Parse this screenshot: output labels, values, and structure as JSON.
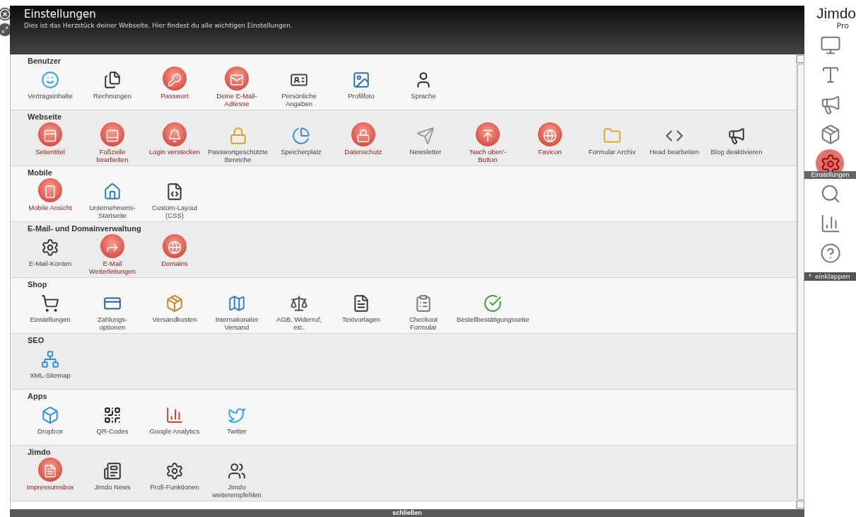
{
  "header": {
    "title": "Einstellungen",
    "subtitle": "Dies ist das Herzstück deiner Webseite. Hier findest du alle wichtigen Einstellungen."
  },
  "sections": [
    {
      "title": "Benutzer",
      "items": [
        {
          "label": "Vertragsinhalte",
          "highlighted": false
        },
        {
          "label": "Rechnungen",
          "highlighted": false
        },
        {
          "label": "Passwort",
          "highlighted": true
        },
        {
          "label": "Deine E-Mail-\nAdresse",
          "highlighted": true
        },
        {
          "label": "Persönliche\nAngaben",
          "highlighted": false
        },
        {
          "label": "Profilfoto",
          "highlighted": false
        },
        {
          "label": "Sprache",
          "highlighted": false
        }
      ]
    },
    {
      "title": "Webseite",
      "items": [
        {
          "label": "Seitentitel",
          "highlighted": true
        },
        {
          "label": "Fußzeile\nbearbeiten",
          "highlighted": true
        },
        {
          "label": "Login verstecken",
          "highlighted": true
        },
        {
          "label": "Passwortgeschützte\nBereiche",
          "highlighted": false
        },
        {
          "label": "Speicherplatz",
          "highlighted": false
        },
        {
          "label": "Datenschutz",
          "highlighted": true
        },
        {
          "label": "Newsletter",
          "highlighted": false
        },
        {
          "label": "'Nach oben'-\nButton",
          "highlighted": true
        },
        {
          "label": "Favicon",
          "highlighted": true
        },
        {
          "label": "Formular Archiv",
          "highlighted": false
        },
        {
          "label": "Head bearbeiten",
          "highlighted": false
        },
        {
          "label": "Blog deaktivieren",
          "highlighted": false
        }
      ]
    },
    {
      "title": "Mobile",
      "items": [
        {
          "label": "Mobile Ansicht",
          "highlighted": true
        },
        {
          "label": "Unternehmens-\nStartseite",
          "highlighted": false
        },
        {
          "label": "Custom-Layout\n(CSS)",
          "highlighted": false
        }
      ]
    },
    {
      "title": "E-Mail- und Domainverwaltung",
      "items": [
        {
          "label": "E-Mail-Konten",
          "highlighted": false
        },
        {
          "label": "E-Mail\nWeiterleitungen",
          "highlighted": true
        },
        {
          "label": "Domains",
          "highlighted": true
        }
      ]
    },
    {
      "title": "Shop",
      "items": [
        {
          "label": "Einstellungen",
          "highlighted": false
        },
        {
          "label": "Zahlungs-\noptionen",
          "highlighted": false
        },
        {
          "label": "Versandkosten",
          "highlighted": false
        },
        {
          "label": "Internationaler\nVersand",
          "highlighted": false
        },
        {
          "label": "AGB, Widerruf,\netc.",
          "highlighted": false
        },
        {
          "label": "Textvorlagen",
          "highlighted": false
        },
        {
          "label": "Checkout\nFormular",
          "highlighted": false
        },
        {
          "label": "Bestellbestätigungsseite",
          "highlighted": false
        }
      ]
    },
    {
      "title": "SEO",
      "items": [
        {
          "label": "XML-Sitemap",
          "highlighted": false
        }
      ]
    },
    {
      "title": "Apps",
      "items": [
        {
          "label": "Dropbox",
          "highlighted": false
        },
        {
          "label": "QR-Codes",
          "highlighted": false
        },
        {
          "label": "Google Analytics",
          "highlighted": false
        },
        {
          "label": "Twitter",
          "highlighted": false
        }
      ]
    },
    {
      "title": "Jimdo",
      "items": [
        {
          "label": "Impressumsbox",
          "highlighted": true
        },
        {
          "label": "Jimdo News",
          "highlighted": false
        },
        {
          "label": "Profi-Funktionen",
          "highlighted": false
        },
        {
          "label": "Jimdo\nweiterempfehlen",
          "highlighted": false
        }
      ]
    }
  ],
  "footer": {
    "close": "schließen"
  },
  "sidebar": {
    "logo": "Jimdo",
    "plan": "Pro",
    "items": [
      {
        "selected": false
      },
      {
        "selected": false
      },
      {
        "selected": false
      },
      {
        "selected": false
      },
      {
        "selected": true,
        "label": "Einstellungen"
      },
      {
        "selected": false
      },
      {
        "selected": false
      },
      {
        "selected": false
      }
    ],
    "collapse": "einklappen"
  }
}
